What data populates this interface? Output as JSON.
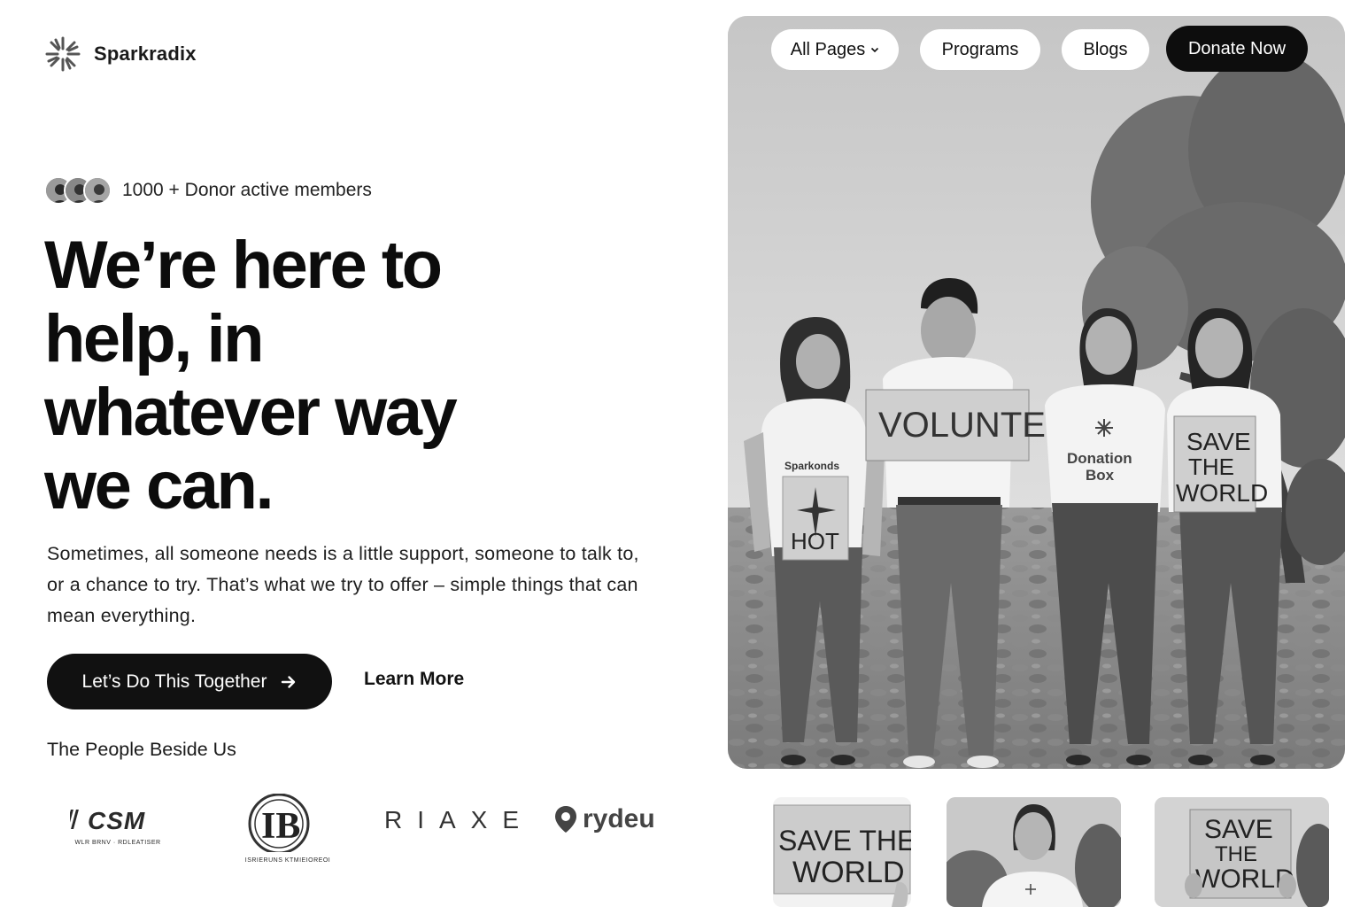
{
  "brand": {
    "name": "Sparkradix"
  },
  "nav": {
    "all_pages": "All Pages",
    "programs": "Programs",
    "blogs": "Blogs",
    "donate": "Donate Now"
  },
  "members": {
    "text": "1000 + Donor active members"
  },
  "hero": {
    "title_lines": [
      "We’re here to",
      "help, in",
      "whatever way",
      "we can."
    ],
    "description": "Sometimes, all someone needs is a little support, someone to talk to, or a chance to try. That’s what we try to offer – simple things that can mean everything.",
    "cta_label": "Let’s Do This Together",
    "learn_more": "Learn More"
  },
  "partners": {
    "heading": "The People Beside Us",
    "logos": [
      {
        "name": "IICSM",
        "tagline": "WLR BRNV · RDLEATISER"
      },
      {
        "name": "IB",
        "tagline": "ISRIERUNS KTMIEIOREOI"
      },
      {
        "name": "RIAXE"
      },
      {
        "name": "rydeu"
      }
    ]
  },
  "photo_signs": {
    "volunteer": "VOLUNTEER",
    "shirt_text": "Sparkonds",
    "hot": "HOT",
    "donation_box": [
      "Donation",
      "Box"
    ],
    "save_world": [
      "SAVE",
      "THE",
      "WORLD"
    ]
  },
  "thumbnails": {
    "first_sign": [
      "SAVE THE",
      "WORLD"
    ],
    "third_sign": [
      "SAVE",
      "THE",
      "WORLD"
    ]
  },
  "colors": {
    "primary": "#111111",
    "background": "#ffffff",
    "pill": "#ffffff"
  },
  "icons": [
    "sparkle-logo-icon",
    "chevron-down-icon",
    "arrow-right-icon",
    "map-pin-icon"
  ]
}
